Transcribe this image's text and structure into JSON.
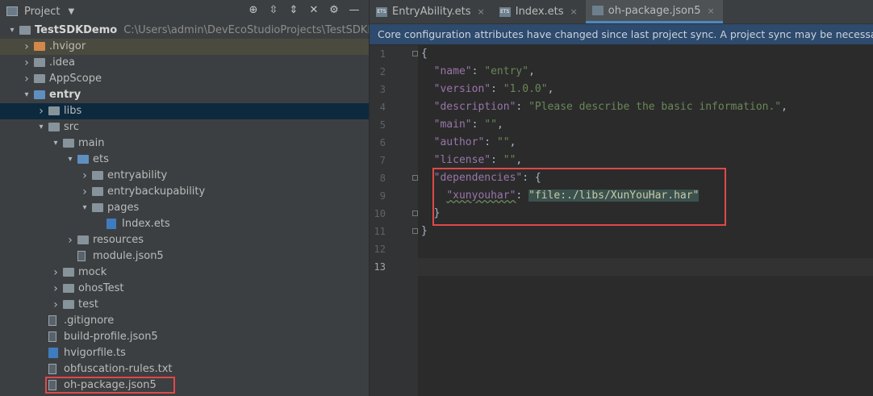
{
  "project_panel": {
    "title": "Project",
    "tree": [
      {
        "label": "TestSDKDemo",
        "path": "C:\\Users\\admin\\DevEcoStudioProjects\\TestSDKDemo",
        "depth": 0,
        "kind": "root",
        "arrow": "open"
      },
      {
        "label": ".hvigor",
        "depth": 1,
        "kind": "folder-orange",
        "arrow": "closed"
      },
      {
        "label": ".idea",
        "depth": 1,
        "kind": "folder",
        "arrow": "closed"
      },
      {
        "label": "AppScope",
        "depth": 1,
        "kind": "folder",
        "arrow": "closed"
      },
      {
        "label": "entry",
        "depth": 1,
        "kind": "folder-blue",
        "arrow": "open"
      },
      {
        "label": "libs",
        "depth": 2,
        "kind": "folder",
        "arrow": "closed"
      },
      {
        "label": "src",
        "depth": 2,
        "kind": "folder",
        "arrow": "open"
      },
      {
        "label": "main",
        "depth": 3,
        "kind": "folder",
        "arrow": "open"
      },
      {
        "label": "ets",
        "depth": 4,
        "kind": "folder-blue",
        "arrow": "open"
      },
      {
        "label": "entryability",
        "depth": 5,
        "kind": "folder",
        "arrow": "closed"
      },
      {
        "label": "entrybackupability",
        "depth": 5,
        "kind": "folder",
        "arrow": "closed"
      },
      {
        "label": "pages",
        "depth": 5,
        "kind": "folder",
        "arrow": "open"
      },
      {
        "label": "Index.ets",
        "depth": 6,
        "kind": "ts",
        "arrow": ""
      },
      {
        "label": "resources",
        "depth": 4,
        "kind": "folder",
        "arrow": "closed"
      },
      {
        "label": "module.json5",
        "depth": 4,
        "kind": "file",
        "arrow": ""
      },
      {
        "label": "mock",
        "depth": 3,
        "kind": "folder",
        "arrow": "closed"
      },
      {
        "label": "ohosTest",
        "depth": 3,
        "kind": "folder",
        "arrow": "closed"
      },
      {
        "label": "test",
        "depth": 3,
        "kind": "folder",
        "arrow": "closed"
      },
      {
        "label": ".gitignore",
        "depth": 2,
        "kind": "file",
        "arrow": ""
      },
      {
        "label": "build-profile.json5",
        "depth": 2,
        "kind": "file",
        "arrow": ""
      },
      {
        "label": "hvigorfile.ts",
        "depth": 2,
        "kind": "ts",
        "arrow": ""
      },
      {
        "label": "obfuscation-rules.txt",
        "depth": 2,
        "kind": "file",
        "arrow": ""
      },
      {
        "label": "oh-package.json5",
        "depth": 2,
        "kind": "file",
        "arrow": ""
      }
    ]
  },
  "tabs": [
    {
      "label": "EntryAbility.ets",
      "icon": "ETS"
    },
    {
      "label": "Index.ets",
      "icon": "ETS"
    },
    {
      "label": "oh-package.json5",
      "icon": "json"
    }
  ],
  "notice": "Core configuration attributes have changed since last project sync. A project sync may be necessary for the IDE to apply the changes properly.",
  "editor": {
    "line_numbers": [
      "1",
      "2",
      "3",
      "4",
      "5",
      "6",
      "7",
      "8",
      "9",
      "10",
      "11",
      "12",
      "13"
    ],
    "lines": [
      {
        "indent": "",
        "parts": [
          {
            "t": "{",
            "c": "p"
          }
        ]
      },
      {
        "indent": "  ",
        "parts": [
          {
            "t": "\"name\"",
            "c": "key"
          },
          {
            "t": ": ",
            "c": "p"
          },
          {
            "t": "\"entry\"",
            "c": "str"
          },
          {
            "t": ",",
            "c": "p"
          }
        ]
      },
      {
        "indent": "  ",
        "parts": [
          {
            "t": "\"version\"",
            "c": "key"
          },
          {
            "t": ": ",
            "c": "p"
          },
          {
            "t": "\"1.0.0\"",
            "c": "str"
          },
          {
            "t": ",",
            "c": "p"
          }
        ]
      },
      {
        "indent": "  ",
        "parts": [
          {
            "t": "\"description\"",
            "c": "key"
          },
          {
            "t": ": ",
            "c": "p"
          },
          {
            "t": "\"Please describe the basic information.\"",
            "c": "str"
          },
          {
            "t": ",",
            "c": "p"
          }
        ]
      },
      {
        "indent": "  ",
        "parts": [
          {
            "t": "\"main\"",
            "c": "key"
          },
          {
            "t": ": ",
            "c": "p"
          },
          {
            "t": "\"\"",
            "c": "str"
          },
          {
            "t": ",",
            "c": "p"
          }
        ]
      },
      {
        "indent": "  ",
        "parts": [
          {
            "t": "\"author\"",
            "c": "key"
          },
          {
            "t": ": ",
            "c": "p"
          },
          {
            "t": "\"\"",
            "c": "str"
          },
          {
            "t": ",",
            "c": "p"
          }
        ]
      },
      {
        "indent": "  ",
        "parts": [
          {
            "t": "\"license\"",
            "c": "key"
          },
          {
            "t": ": ",
            "c": "p"
          },
          {
            "t": "\"\"",
            "c": "str"
          },
          {
            "t": ",",
            "c": "p"
          }
        ]
      },
      {
        "indent": "  ",
        "parts": [
          {
            "t": "\"dependencies\"",
            "c": "key"
          },
          {
            "t": ": {",
            "c": "p"
          }
        ]
      },
      {
        "indent": "    ",
        "parts": [
          {
            "t": "\"xunyouhar\"",
            "c": "key wavy"
          },
          {
            "t": ": ",
            "c": "p"
          },
          {
            "t": "\"file:./libs/XunYouHar.har\"",
            "c": "strbg"
          }
        ]
      },
      {
        "indent": "  ",
        "parts": [
          {
            "t": "}",
            "c": "p"
          }
        ]
      },
      {
        "indent": "",
        "parts": [
          {
            "t": "}",
            "c": "p"
          }
        ]
      },
      {
        "indent": "",
        "parts": []
      },
      {
        "indent": "",
        "parts": []
      }
    ]
  },
  "colors": {
    "highlight_box": "#e0484a",
    "json_key": "#9876aa",
    "json_string": "#6a8759",
    "notice_bg": "#2e4a6d"
  }
}
